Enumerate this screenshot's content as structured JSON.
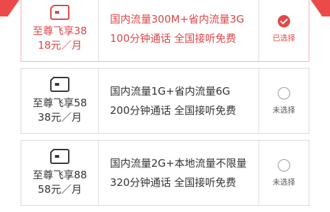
{
  "plans": [
    {
      "name": "至尊飞享38",
      "price": "18元／月",
      "data_line": "国内流量300M+省内流量3G",
      "call_line": "100分钟通话   全国接听免费",
      "status": "已选择",
      "selected": true,
      "icon": "sim-card-icon"
    },
    {
      "name": "至尊飞享58",
      "price": "38元／月",
      "data_line": "国内流量1G+省内流量6G",
      "call_line": "200分钟通话   全国接听免费",
      "status": "未选择",
      "selected": false,
      "icon": "sim-card-icon"
    },
    {
      "name": "至尊飞享88",
      "price": "58元／月",
      "data_line": "国内流量2G+本地流量不限量",
      "call_line": "320分钟通话   全国接听免费",
      "status": "未选择",
      "selected": false,
      "icon": "sim-card-icon"
    }
  ],
  "colors": {
    "accent": "#e04545",
    "border": "#d9d9d9",
    "text": "#333333"
  }
}
